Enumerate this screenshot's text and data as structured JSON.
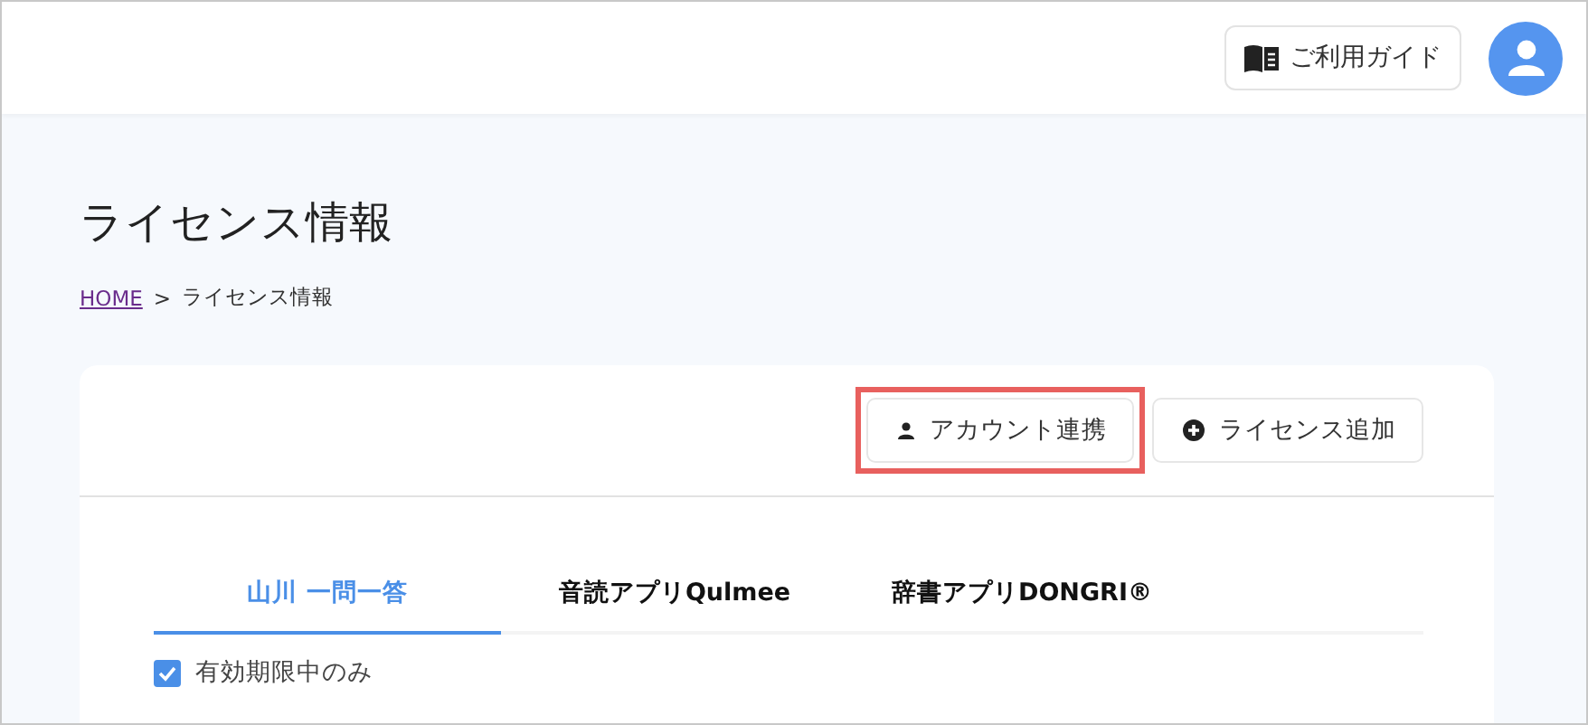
{
  "header": {
    "guide_button": {
      "label": "ご利用ガイド"
    }
  },
  "page": {
    "title": "ライセンス情報",
    "breadcrumb": [
      {
        "label": "HOME",
        "kind": "link"
      },
      {
        "label": ">",
        "kind": "separator"
      },
      {
        "label": "ライセンス情報",
        "kind": "current"
      }
    ]
  },
  "actions": [
    {
      "label": "アカウント連携",
      "kind": "person",
      "highlighted": true
    },
    {
      "label": "ライセンス追加",
      "kind": "plus",
      "highlighted": false
    }
  ],
  "tabs": [
    {
      "label": "山川 一問一答",
      "selected": true
    },
    {
      "label": "音読アプリQulmee",
      "selected": false
    },
    {
      "label": "辞書アプリDONGRI®",
      "selected": false
    }
  ],
  "filter": {
    "label": "有効期限中のみ",
    "checked": true
  }
}
